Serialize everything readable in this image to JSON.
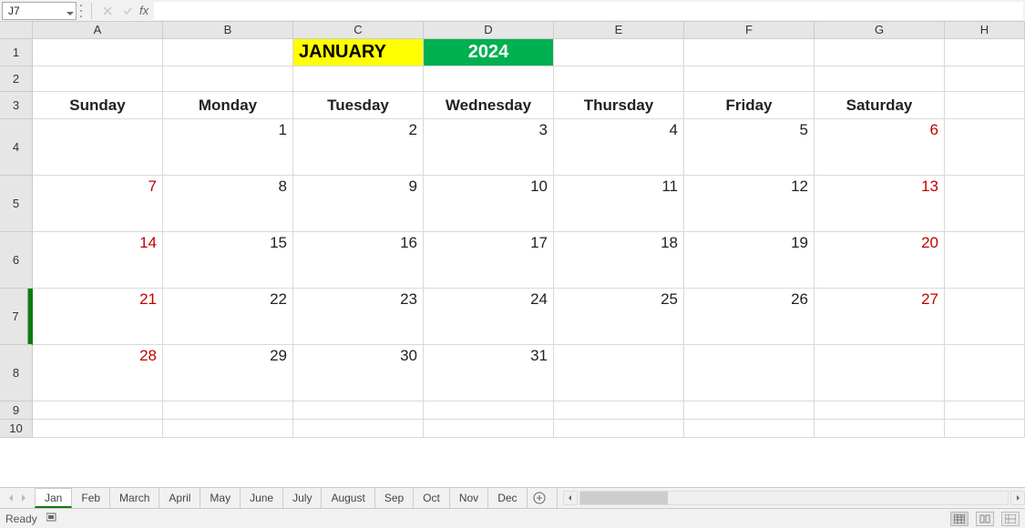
{
  "formula_bar": {
    "name_box": "J7",
    "fx_label": "fx",
    "formula_value": ""
  },
  "columns": [
    "A",
    "B",
    "C",
    "D",
    "E",
    "F",
    "G",
    "H"
  ],
  "rows": [
    "1",
    "2",
    "3",
    "4",
    "5",
    "6",
    "7",
    "8",
    "9",
    "10"
  ],
  "title": {
    "month": "JANUARY",
    "year": "2024"
  },
  "weekdays": [
    "Sunday",
    "Monday",
    "Tuesday",
    "Wednesday",
    "Thursday",
    "Friday",
    "Saturday"
  ],
  "calendar": [
    [
      "",
      "1",
      "2",
      "3",
      "4",
      "5",
      "6"
    ],
    [
      "7",
      "8",
      "9",
      "10",
      "11",
      "12",
      "13"
    ],
    [
      "14",
      "15",
      "16",
      "17",
      "18",
      "19",
      "20"
    ],
    [
      "21",
      "22",
      "23",
      "24",
      "25",
      "26",
      "27"
    ],
    [
      "28",
      "29",
      "30",
      "31",
      "",
      "",
      ""
    ]
  ],
  "selected_cell": "J7",
  "tabs": [
    "Jan",
    "Feb",
    "March",
    "April",
    "May",
    "June",
    "July",
    "August",
    "Sep",
    "Oct",
    "Nov",
    "Dec"
  ],
  "active_tab": 0,
  "status": {
    "ready": "Ready"
  }
}
